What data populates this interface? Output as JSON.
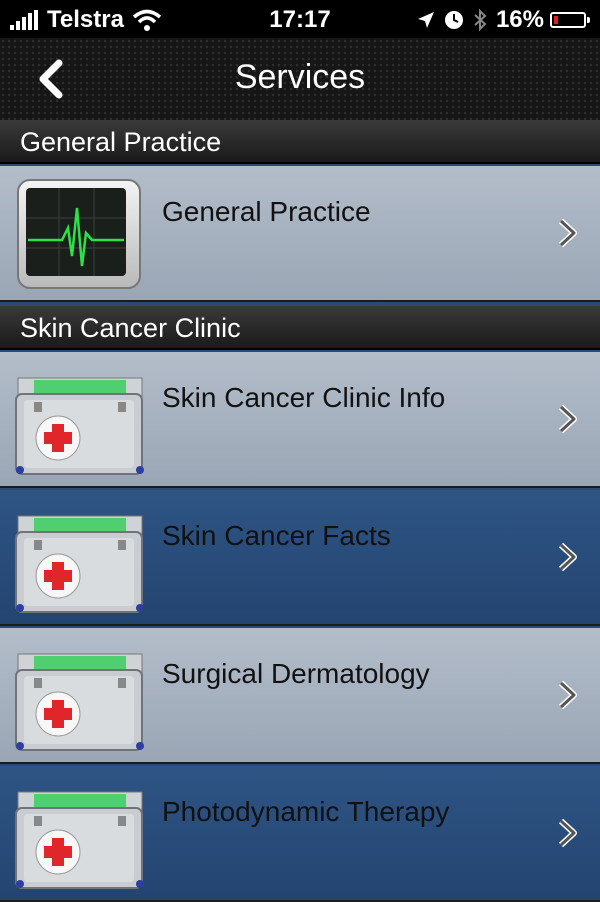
{
  "status_bar": {
    "carrier": "Telstra",
    "time": "17:17",
    "battery": "16%",
    "battery_level": 0.16,
    "icons": [
      "signal-icon",
      "wifi-icon",
      "location-icon",
      "clock-icon",
      "bluetooth-icon",
      "battery-icon"
    ]
  },
  "nav": {
    "title": "Services",
    "back_icon": "chevron-left-icon"
  },
  "sections": [
    {
      "title": "General Practice",
      "items": [
        {
          "label": "General Practice",
          "icon": "heart-monitor-icon",
          "style": "light"
        }
      ]
    },
    {
      "title": "Skin Cancer Clinic",
      "items": [
        {
          "label": "Skin Cancer Clinic Info",
          "icon": "medical-kit-icon",
          "style": "light"
        },
        {
          "label": "Skin Cancer Facts",
          "icon": "medical-kit-icon",
          "style": "dark"
        },
        {
          "label": "Surgical Dermatology",
          "icon": "medical-kit-icon",
          "style": "light"
        },
        {
          "label": "Photodynamic Therapy",
          "icon": "medical-kit-icon",
          "style": "dark"
        }
      ]
    }
  ],
  "colors": {
    "light_row": "#a9b4c2",
    "dark_row": "#2a4e7c",
    "medical_cross": "#e0262b",
    "monitor_trace": "#2ee04a"
  }
}
